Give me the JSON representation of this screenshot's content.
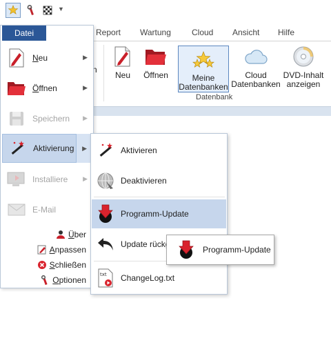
{
  "tabs": [
    "Report",
    "Wartung",
    "Cloud",
    "Ansicht",
    "Hilfe"
  ],
  "ribbon": {
    "partial_label": "n",
    "buttons": [
      {
        "label1": "Neu",
        "label2": ""
      },
      {
        "label1": "Öffnen",
        "label2": ""
      },
      {
        "label1": "Meine",
        "label2": "Datenbanken"
      },
      {
        "label1": "Cloud",
        "label2": "Datenbanken"
      },
      {
        "label1": "DVD-Inhalt",
        "label2": "anzeigen"
      }
    ],
    "group_label": "Datenbank"
  },
  "file_menu": {
    "title": "Datei",
    "items": [
      {
        "label": "Neu",
        "underline": "N",
        "rest": "eu",
        "enabled": true
      },
      {
        "label": "Öffnen",
        "underline": "Ö",
        "rest": "ffnen",
        "enabled": true
      },
      {
        "label": "Speichern",
        "enabled": false
      },
      {
        "label": "Aktivierung",
        "enabled": true
      },
      {
        "label": "Installiere",
        "enabled": false
      },
      {
        "label": "E-Mail",
        "enabled": false
      }
    ],
    "bottom": [
      {
        "label": "Über",
        "underline": "Ü",
        "rest": "ber"
      },
      {
        "label": "Anpassen",
        "underline": "A",
        "rest": "npassen"
      },
      {
        "label": "Schließen",
        "underline": "S",
        "rest": "chließen"
      },
      {
        "label": "Optionen",
        "underline": "O",
        "rest": "ptionen"
      }
    ]
  },
  "submenu": {
    "items": [
      "Aktivieren",
      "Deaktivieren",
      "Programm-Update",
      "Update rückg",
      "ChangeLog.txt"
    ]
  },
  "tooltip": {
    "label": "Programm-Update"
  },
  "colors": {
    "accent": "#2b5797",
    "highlight": "#c6d6ec",
    "red": "#d9232d"
  }
}
